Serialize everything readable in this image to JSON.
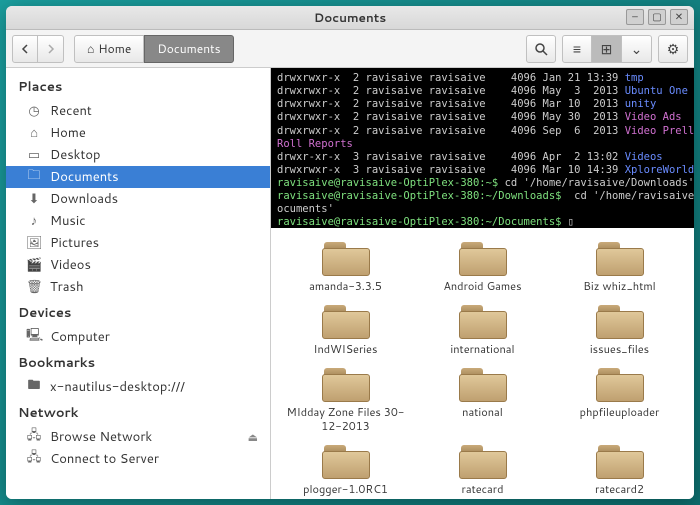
{
  "window": {
    "title": "Documents"
  },
  "toolbar": {
    "path_home": "Home",
    "path_current": "Documents"
  },
  "sidebar": {
    "places_header": "Places",
    "places": [
      {
        "icon": "◷",
        "label": "Recent"
      },
      {
        "icon": "⌂",
        "label": "Home"
      },
      {
        "icon": "▭",
        "label": "Desktop"
      },
      {
        "icon": "🗀",
        "label": "Documents",
        "selected": true
      },
      {
        "icon": "⬇",
        "label": "Downloads"
      },
      {
        "icon": "♪",
        "label": "Music"
      },
      {
        "icon": "🖼",
        "label": "Pictures"
      },
      {
        "icon": "🎬",
        "label": "Videos"
      },
      {
        "icon": "🗑",
        "label": "Trash"
      }
    ],
    "devices_header": "Devices",
    "devices": [
      {
        "icon": "🖳",
        "label": "Computer"
      }
    ],
    "bookmarks_header": "Bookmarks",
    "bookmarks": [
      {
        "icon": "🖿",
        "label": "x-nautilus-desktop:///"
      }
    ],
    "network_header": "Network",
    "network": [
      {
        "icon": "🖧",
        "label": "Browse Network",
        "eject": true
      },
      {
        "icon": "🖧",
        "label": "Connect to Server"
      }
    ]
  },
  "terminal": {
    "lines": [
      {
        "perm": "drwxrwxr-x  2 ravisaive ravisaive    4096 Jan 21 13:39 ",
        "t": "tmp",
        "cls": "t-blue"
      },
      {
        "perm": "drwxrwxr-x  2 ravisaive ravisaive    4096 May  3  2013 ",
        "t": "Ubuntu One",
        "cls": "t-blue"
      },
      {
        "perm": "drwxrwxr-x  2 ravisaive ravisaive    4096 Mar 10  2013 ",
        "t": "unity",
        "cls": "t-blue"
      },
      {
        "perm": "drwxrwxr-x  2 ravisaive ravisaive    4096 May 30  2013 ",
        "t": "Video Ads",
        "cls": "t-pink"
      },
      {
        "perm": "drwxrwxr-x  2 ravisaive ravisaive    4096 Sep  6  2013 ",
        "t": "Video Prell",
        "cls": "t-pink"
      },
      {
        "perm": "",
        "t": "Roll Reports",
        "cls": "t-pink"
      },
      {
        "perm": "drwxr-xr-x  3 ravisaive ravisaive    4096 Apr  2 13:02 ",
        "t": "Videos",
        "cls": "t-blue"
      },
      {
        "perm": "drwxrwxr-x  3 ravisaive ravisaive    4096 Mar 10 14:39 ",
        "t": "XploreWorld",
        "cls": "t-blue"
      }
    ],
    "cmd1_prompt": "ravisaive@ravisaive-OptiPlex-380:~$ ",
    "cmd1": "cd '/home/ravisaive/Downloads'",
    "cmd2_prompt": "ravisaive@ravisaive-OptiPlex-380:~/Downloads$ ",
    "cmd2": " cd '/home/ravisaive/Documents'",
    "cmd2_wrap": "ocuments'",
    "cmd3_prompt": "ravisaive@ravisaive-OptiPlex-380:~/Documents$ ",
    "cursor": "▯"
  },
  "files": [
    {
      "label": "amanda-3.3.5"
    },
    {
      "label": "Android Games"
    },
    {
      "label": "Biz whiz_html"
    },
    {
      "label": "IndWISeries"
    },
    {
      "label": "international"
    },
    {
      "label": "issues_files"
    },
    {
      "label": "MIdday Zone Files 30-12-2013"
    },
    {
      "label": "national"
    },
    {
      "label": "phpfileuploader"
    },
    {
      "label": "plogger-1.0RC1"
    },
    {
      "label": "ratecard"
    },
    {
      "label": "ratecard2"
    }
  ]
}
